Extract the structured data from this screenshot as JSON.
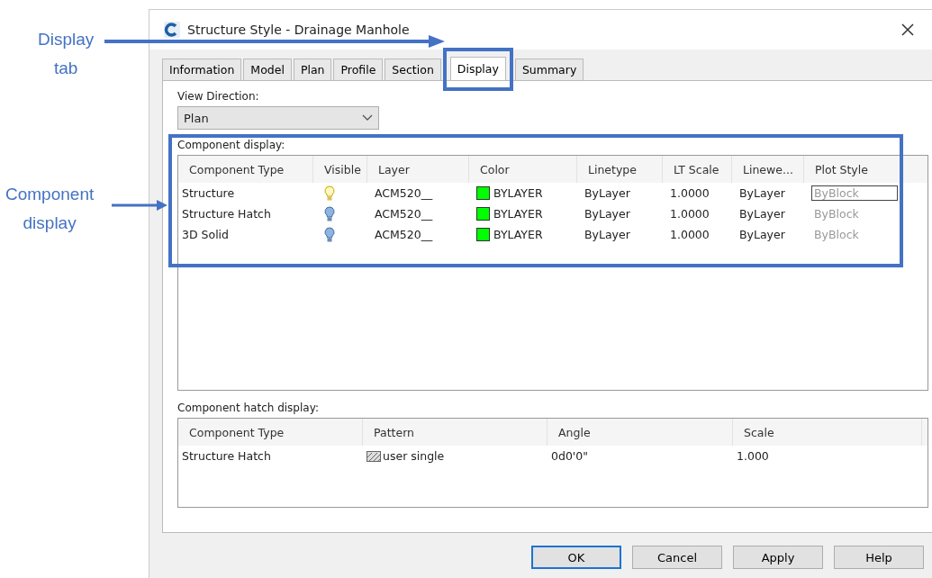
{
  "annotations": [
    {
      "kind": "tab",
      "text": "Display\ntab"
    },
    {
      "kind": "panel",
      "text": "Component\ndisplay"
    }
  ],
  "window": {
    "title": "Structure Style - Drainage Manhole"
  },
  "tabs": [
    {
      "label": "Information",
      "selected": false
    },
    {
      "label": "Model",
      "selected": false
    },
    {
      "label": "Plan",
      "selected": false
    },
    {
      "label": "Profile",
      "selected": false
    },
    {
      "label": "Section",
      "selected": false
    },
    {
      "label": "Display",
      "selected": true
    },
    {
      "label": "Summary",
      "selected": false
    }
  ],
  "view_direction": {
    "label": "View Direction:",
    "value": "Plan"
  },
  "component_display": {
    "label": "Component display:",
    "columns": [
      "Component Type",
      "Visible",
      "Layer",
      "Color",
      "Linetype",
      "LT Scale",
      "Linewe...",
      "Plot Style"
    ],
    "rows": [
      {
        "component_type": "Structure",
        "visible": true,
        "layer": "ACM520__",
        "color": "#00ff00",
        "color_name": "BYLAYER",
        "linetype": "ByLayer",
        "lt_scale": "1.0000",
        "lineweight": "ByLayer",
        "plot_style": "ByBlock",
        "selected": true
      },
      {
        "component_type": "Structure Hatch",
        "visible": false,
        "layer": "ACM520__",
        "color": "#00ff00",
        "color_name": "BYLAYER",
        "linetype": "ByLayer",
        "lt_scale": "1.0000",
        "lineweight": "ByLayer",
        "plot_style": "ByBlock",
        "selected": false
      },
      {
        "component_type": "3D Solid",
        "visible": false,
        "layer": "ACM520__",
        "color": "#00ff00",
        "color_name": "BYLAYER",
        "linetype": "ByLayer",
        "lt_scale": "1.0000",
        "lineweight": "ByLayer",
        "plot_style": "ByBlock",
        "selected": false
      }
    ]
  },
  "hatch_display": {
    "label": "Component hatch display:",
    "columns": [
      "Component Type",
      "Pattern",
      "Angle",
      "Scale"
    ],
    "rows": [
      {
        "component_type": "Structure Hatch",
        "pattern": "user single",
        "angle": "0d0'0\"",
        "scale": "1.000"
      }
    ]
  },
  "buttons": [
    {
      "label": "OK",
      "selected": true
    },
    {
      "label": "Cancel",
      "selected": false
    },
    {
      "label": "Apply",
      "selected": false
    },
    {
      "label": "Help",
      "selected": false
    }
  ]
}
